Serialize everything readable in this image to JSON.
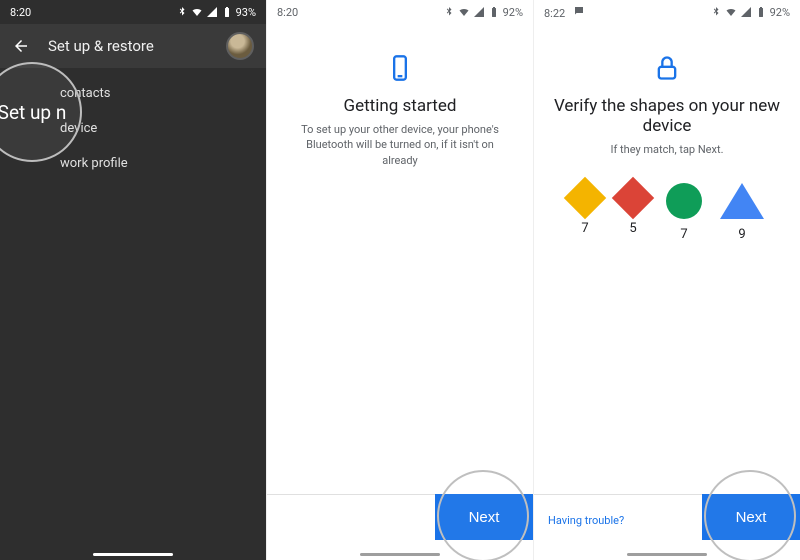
{
  "panel1": {
    "status": {
      "time": "8:20",
      "battery": "93%"
    },
    "appbar": {
      "title": "Set up & restore"
    },
    "items": [
      "contacts",
      "device",
      "work profile"
    ],
    "callout": "Set up n"
  },
  "panel2": {
    "status": {
      "time": "8:20",
      "battery": "92%"
    },
    "title": "Getting started",
    "subtitle": "To set up your other device, your phone's Bluetooth will be turned on, if it isn't on already",
    "next_label": "Next"
  },
  "panel3": {
    "status": {
      "time": "8:22",
      "battery": "92%"
    },
    "title": "Verify the shapes on your new device",
    "subtitle": "If they match, tap Next.",
    "shapes": [
      {
        "kind": "diamond-orange",
        "value": "7"
      },
      {
        "kind": "diamond-red",
        "value": "5"
      },
      {
        "kind": "circle-green",
        "value": "7"
      },
      {
        "kind": "triangle-blue",
        "value": "9"
      }
    ],
    "trouble_label": "Having trouble?",
    "next_label": "Next"
  },
  "colors": {
    "accent": "#1a73e8",
    "orange": "#f4b400",
    "red": "#db4437",
    "green": "#0f9d58",
    "blue": "#4285f4"
  }
}
